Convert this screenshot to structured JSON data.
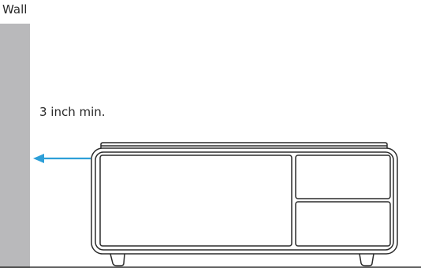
{
  "diagram": {
    "wall_label": "Wall",
    "clearance_label": "3 inch min.",
    "colors": {
      "wall": "#b9b9bb",
      "arrow": "#2d9fd8",
      "outline": "#2b2b2b",
      "floor": "#2b2b2b"
    }
  }
}
